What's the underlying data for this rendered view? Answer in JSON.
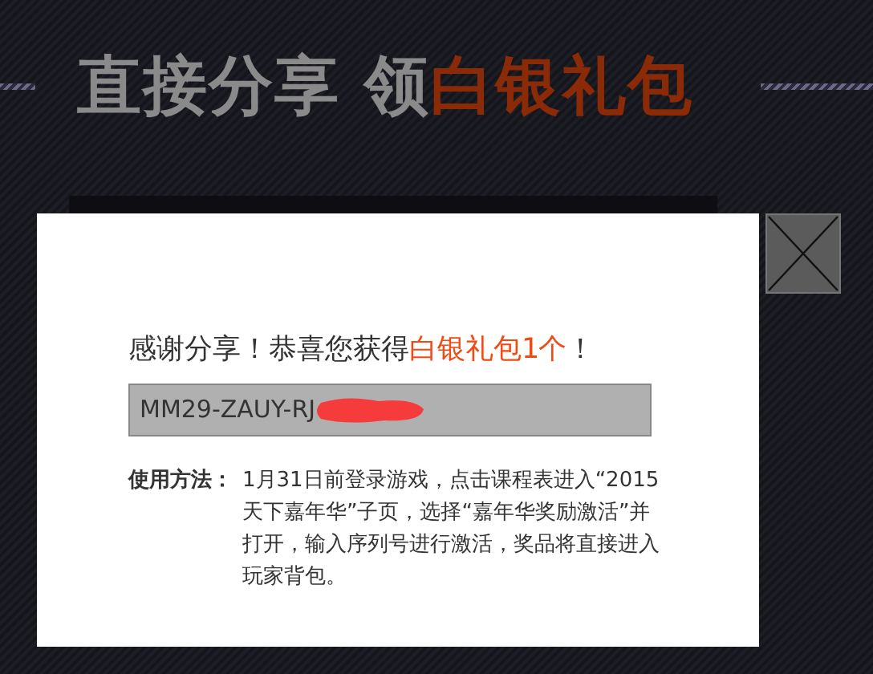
{
  "headline": [
    {
      "text": "直接分享 领",
      "kind": "plain"
    },
    {
      "text": "白银礼包",
      "kind": "highlight"
    }
  ],
  "dialog": {
    "message": [
      {
        "text": "感谢分享！恭喜您获得",
        "kind": "plain"
      },
      {
        "text": "白银礼包1个",
        "kind": "highlight"
      },
      {
        "text": "！",
        "kind": "plain"
      }
    ],
    "code_field": {
      "value": "MM29-ZAUY-RJ",
      "redacted": true
    },
    "usage": {
      "label": "使用方法：",
      "text": "1月31日前登录游戏，点击课程表进入“2015天下嘉年华”子页，选择“嘉年华奖励激活”并打开，输入序列号进行激活，奖品将直接进入玩家背包。"
    }
  }
}
